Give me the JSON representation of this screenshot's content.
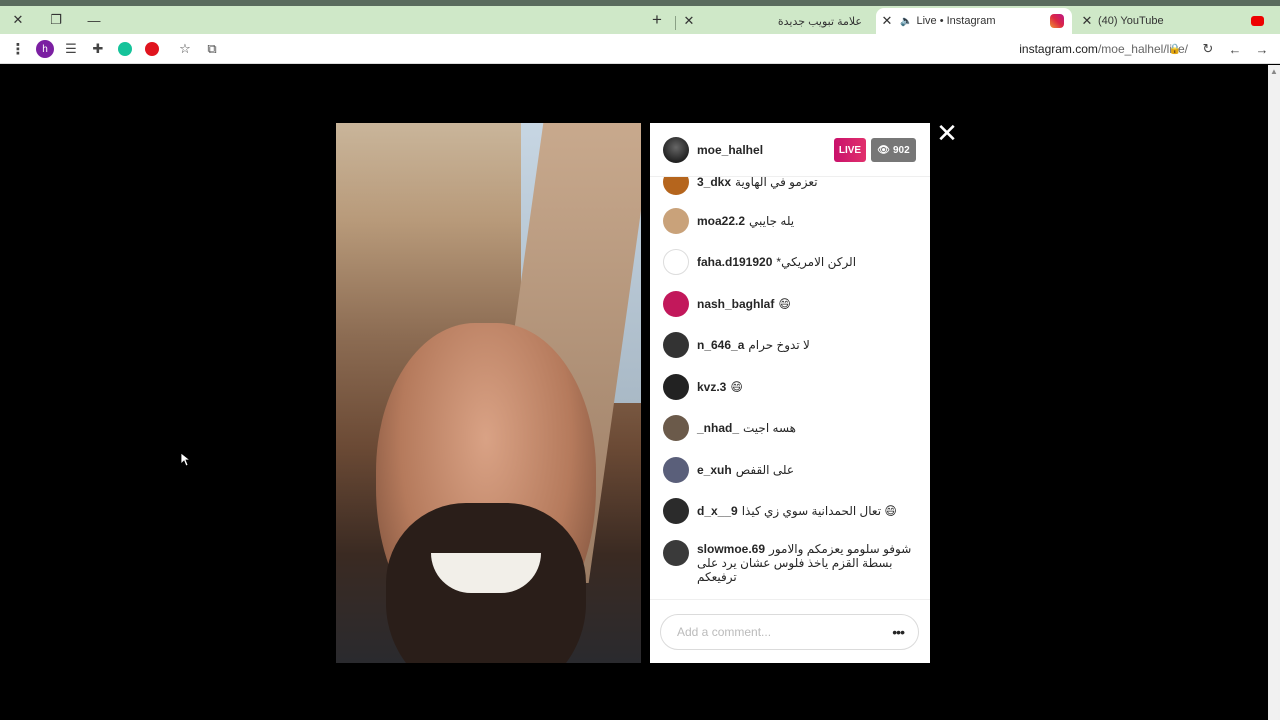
{
  "browser": {
    "tabs": [
      {
        "title": "علامة تبويب جديدة",
        "active": false
      },
      {
        "title": "Live • Instagram",
        "active": true
      },
      {
        "title": "(40) YouTube",
        "active": false
      }
    ],
    "url_host": "instagram.com",
    "url_path": "/moe_halhel/live/"
  },
  "live": {
    "host": "moe_halhel",
    "live_label": "LIVE",
    "viewers": "902",
    "comments": [
      {
        "user": "3_dkx",
        "msg": "تعزمو في الهاوية",
        "avatar": "#b5651d"
      },
      {
        "user": "moa22.2",
        "msg": "يله جايبي",
        "avatar": "#c9a27a"
      },
      {
        "user": "faha.d191920",
        "msg": "*الركن الامريكي",
        "avatar": "#e0e0e0"
      },
      {
        "user": "nash_baghlaf",
        "msg": "😄",
        "avatar": "#c2185b"
      },
      {
        "user": "n_646_a",
        "msg": "لا تدوخ حرام",
        "avatar": "#333333"
      },
      {
        "user": "kvz.3",
        "msg": "😄",
        "avatar": "#222222"
      },
      {
        "user": "_nhad_",
        "msg": "هسه اجيت",
        "avatar": "#6b5a4a"
      },
      {
        "user": "e_xuh",
        "msg": "على القفص",
        "avatar": "#5a5f7a"
      },
      {
        "user": "d_x__9",
        "msg": "تعال الحمدانية سوي زي كيذا 😄",
        "avatar": "#2b2b2b"
      },
      {
        "user": "slowmoe.69",
        "msg": "شوفو سلومو يعزمكم والامور بسطة القزم ياخذ فلوس عشان يرد على ترفيعكم",
        "avatar": "#3a3a3a"
      }
    ],
    "comment_placeholder": "Add a comment..."
  }
}
